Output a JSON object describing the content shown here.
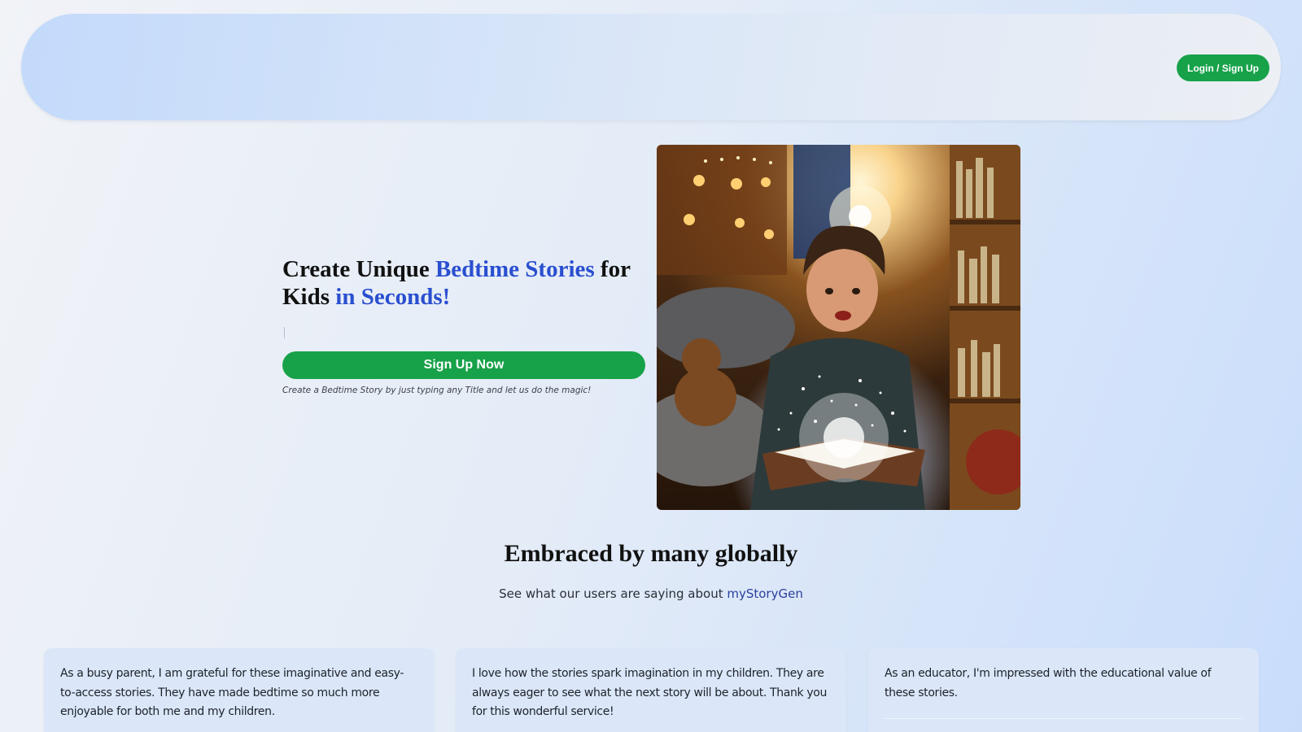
{
  "header": {
    "login_label": "Login / Sign Up"
  },
  "hero": {
    "title_part1": "Create Unique ",
    "title_accent1": "Bedtime Stories",
    "title_part2": " for Kids ",
    "title_accent2": "in Seconds!",
    "signup_label": "Sign Up Now",
    "note": "Create a Bedtime Story by just typing any Title and let us do the magic!",
    "image_icon": "boy-reading-glowing-book-illustration"
  },
  "testimonials_section": {
    "title": "Embraced by many globally",
    "subtitle_prefix": "See what our users are saying about ",
    "brand": "myStoryGen"
  },
  "testimonials": [
    {
      "text": "As a busy parent, I am grateful for these imaginative and easy-to-access stories. They have made bedtime so much more enjoyable for both me and my children."
    },
    {
      "text": "I love how the stories spark imagination in my children. They are always eager to see what the next story will be about. Thank you for this wonderful service!"
    },
    {
      "text": "As an educator, I'm impressed with the educational value of these stories."
    }
  ],
  "colors": {
    "accent_blue": "#2a4fd0",
    "cta_green": "#17a24a",
    "brand_link": "#2a3f9d"
  }
}
